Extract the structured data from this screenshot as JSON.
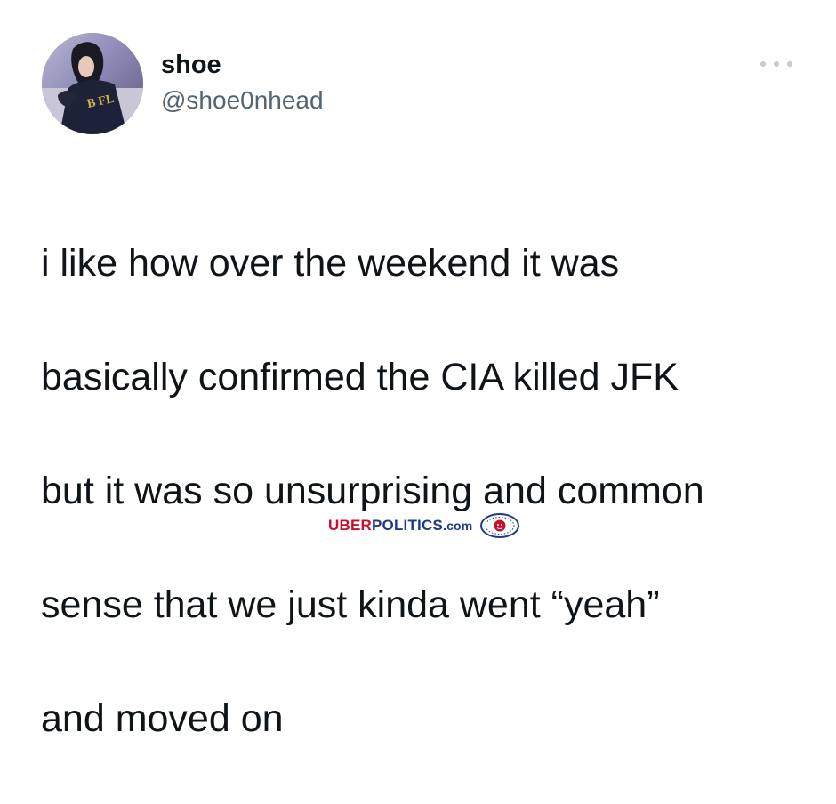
{
  "tweet": {
    "display_name": "shoe",
    "handle": "@shoe0nhead",
    "text_lines": [
      "i like how over the weekend it was",
      "basically confirmed the CIA killed JFK",
      "but it was so unsurprising and common",
      "sense that we just kinda went “yeah”",
      "and moved on"
    ],
    "more_icon": "ellipsis-icon"
  },
  "watermark": {
    "part1": "UBER",
    "part2": "POLITICS",
    "part3": ".com",
    "logo_icon": "lion-seal-icon"
  },
  "colors": {
    "text": "#0f1419",
    "secondary": "#536471",
    "watermark_red": "#c8102e",
    "watermark_blue": "#1f3a8a"
  }
}
